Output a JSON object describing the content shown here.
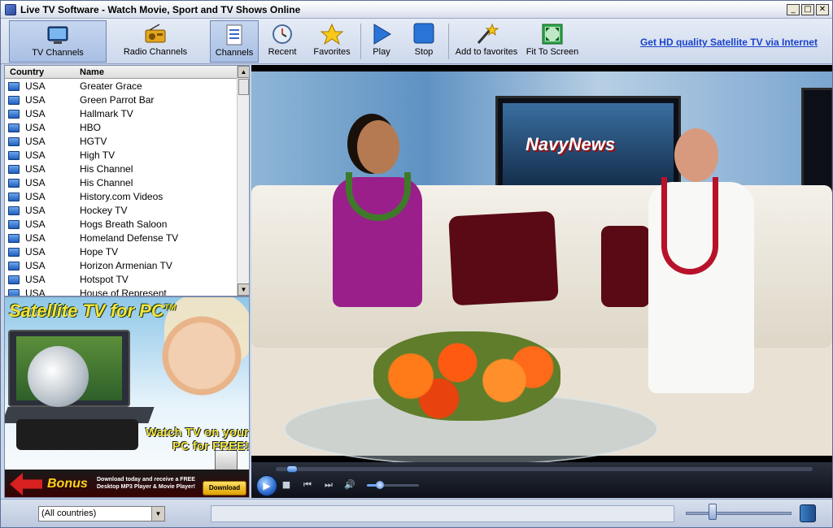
{
  "window": {
    "title": "Live TV Software - Watch Movie, Sport and TV Shows Online",
    "controls": {
      "minimize": "_",
      "maximize": "□",
      "close": "✕"
    }
  },
  "toolbar": {
    "buttons": [
      {
        "label": "TV Channels",
        "icon": "tv-icon"
      },
      {
        "label": "Radio Channels",
        "icon": "radio-icon"
      },
      {
        "label": "Channels",
        "icon": "list-icon"
      },
      {
        "label": "Recent",
        "icon": "clock-icon"
      },
      {
        "label": "Favorites",
        "icon": "star-icon"
      },
      {
        "label": "Play",
        "icon": "play-icon"
      },
      {
        "label": "Stop",
        "icon": "stop-icon"
      },
      {
        "label": "Add to favorites",
        "icon": "magic-wand-icon"
      },
      {
        "label": "Fit To Screen",
        "icon": "fit-screen-icon"
      }
    ],
    "promo_link": "Get HD quality Satellite TV via Internet"
  },
  "channel_list": {
    "columns": {
      "country": "Country",
      "name": "Name"
    },
    "rows": [
      {
        "country": "USA",
        "name": "Greater Grace"
      },
      {
        "country": "USA",
        "name": "Green Parrot Bar"
      },
      {
        "country": "USA",
        "name": "Hallmark TV"
      },
      {
        "country": "USA",
        "name": "HBO"
      },
      {
        "country": "USA",
        "name": "HGTV"
      },
      {
        "country": "USA",
        "name": "High TV"
      },
      {
        "country": "USA",
        "name": "His Channel"
      },
      {
        "country": "USA",
        "name": "His Channel"
      },
      {
        "country": "USA",
        "name": "History.com Videos"
      },
      {
        "country": "USA",
        "name": "Hockey TV"
      },
      {
        "country": "USA",
        "name": "Hogs Breath Saloon"
      },
      {
        "country": "USA",
        "name": "Homeland Defense TV"
      },
      {
        "country": "USA",
        "name": "Hope TV"
      },
      {
        "country": "USA",
        "name": "Horizon Armenian TV"
      },
      {
        "country": "USA",
        "name": "Hotspot TV"
      },
      {
        "country": "USA",
        "name": "House of Represent"
      }
    ]
  },
  "ad": {
    "headline": "Satellite TV for PC",
    "trademark": "TM",
    "tagline": "Watch TV on your PC for FREE!",
    "bonus": "Bonus",
    "bonus_text": "Download today and receive a FREE Desktop MP3 Player & Movie Player!",
    "download_button": "Download Now"
  },
  "video": {
    "onscreen_text": "NavyNews"
  },
  "player": {
    "play_symbol": "▶",
    "stop_symbol": "■",
    "prev_symbol": "⏮",
    "next_symbol": "⏭",
    "volume_symbol": "🔊",
    "seek_fraction": 0.02,
    "volume_fraction": 0.25
  },
  "status": {
    "country_filter": "(All countries)",
    "volume_fraction": 0.25
  }
}
